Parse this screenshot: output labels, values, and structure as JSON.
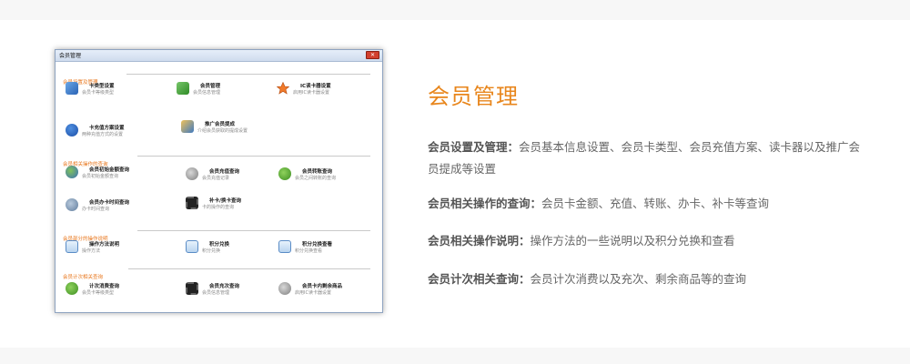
{
  "window": {
    "title": "会员管理",
    "close_glyph": "✕",
    "sections": [
      {
        "title": "会员设置及管理",
        "items": [
          {
            "name": "卡类型设置",
            "desc": "会员卡等级类型",
            "icon": "pen-icon"
          },
          {
            "name": "会员管理",
            "desc": "会员信息管理",
            "icon": "phone-icon"
          },
          {
            "name": "IC读卡器设置",
            "desc": "启用IC读卡器设置",
            "icon": "star-icon"
          },
          {
            "name": "卡充值方案设置",
            "desc": "两种充值方式的设置",
            "icon": "info-icon"
          },
          {
            "name": "推广会员提成",
            "desc": "介绍会员获取的提成设置",
            "icon": "card-icon"
          }
        ]
      },
      {
        "title": "会员相关操作的查询",
        "items": [
          {
            "name": "会员初始金额查询",
            "desc": "会员初始金额查询",
            "icon": "people-icon"
          },
          {
            "name": "会员充值查询",
            "desc": "会员充值记录",
            "icon": "coin-icon"
          },
          {
            "name": "会员转账查询",
            "desc": "会员之间转账的查询",
            "icon": "key-icon"
          },
          {
            "name": "会员办卡时间查询",
            "desc": "办卡时间查询",
            "icon": "globe-icon"
          },
          {
            "name": "补卡/换卡查询",
            "desc": "卡的操作的查询",
            "icon": "film-icon"
          }
        ]
      },
      {
        "title": "会员部分的操作说明",
        "items": [
          {
            "name": "操作方法说明",
            "desc": "操作方法",
            "icon": "chart-icon"
          },
          {
            "name": "积分兑换",
            "desc": "积分兑换",
            "icon": "chart-icon"
          },
          {
            "name": "积分兑换查看",
            "desc": "积分兑换查看",
            "icon": "chart-icon"
          }
        ]
      },
      {
        "title": "会员计次相关查询",
        "items": [
          {
            "name": "计次消费查询",
            "desc": "会员卡等级类型",
            "icon": "key-icon"
          },
          {
            "name": "会员充次查询",
            "desc": "会员信息管理",
            "icon": "film-icon"
          },
          {
            "name": "会员卡内剩余商品",
            "desc": "启用IC读卡器设置",
            "icon": "coin-icon"
          }
        ]
      }
    ]
  },
  "intro": {
    "heading": "会员管理",
    "paragraphs": [
      {
        "label": "会员设置及管理：",
        "text": "会员基本信息设置、会员卡类型、会员充值方案、读卡器以及推广会员提成等设置"
      },
      {
        "label": "会员相关操作的查询：",
        "text": "会员卡金额、充值、转账、办卡、补卡等查询"
      },
      {
        "label": "会员相关操作说明：",
        "text": "操作方法的一些说明以及积分兑换和查看"
      },
      {
        "label": "会员计次相关查询：",
        "text": "会员计次消费以及充次、剩余商品等的查询"
      }
    ]
  },
  "colors": {
    "accent": "#e8861c",
    "section_title": "#e8761c",
    "body_text": "#666666"
  }
}
